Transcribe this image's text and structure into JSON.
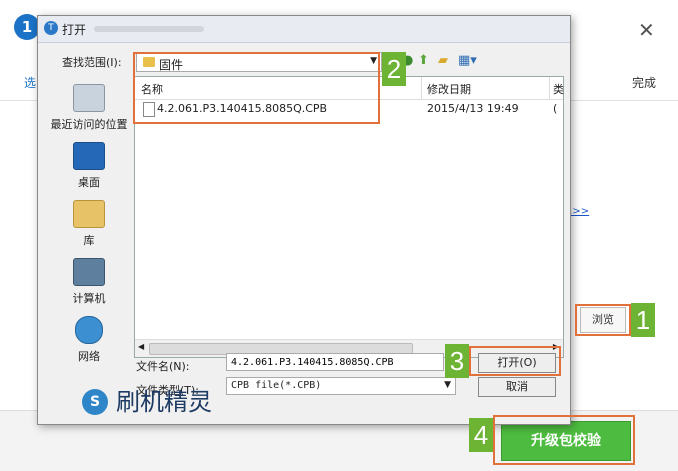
{
  "background": {
    "step_number": "1",
    "close_glyph": "✕",
    "tab_left": "选",
    "tab_right": "完成",
    "link_text": "..>>",
    "browse_label": "浏览",
    "upgrade_label": "升级包校验"
  },
  "dialog": {
    "title": "打开",
    "lookin_label": "查找范围(I):",
    "lookin_value": "固件",
    "places": [
      {
        "label": "最近访问的位置",
        "icon": "recent-places-icon"
      },
      {
        "label": "桌面",
        "icon": "desktop-icon"
      },
      {
        "label": "库",
        "icon": "library-icon"
      },
      {
        "label": "计算机",
        "icon": "computer-icon"
      },
      {
        "label": "网络",
        "icon": "network-icon"
      }
    ],
    "columns": {
      "name": "名称",
      "date": "修改日期",
      "extra": "类"
    },
    "files": [
      {
        "name": "4.2.061.P3.140415.8085Q.CPB",
        "date": "2015/4/13 19:49",
        "extra": "("
      }
    ],
    "filename_label": "文件名(N):",
    "filename_value": "4.2.061.P3.140415.8085Q.CPB",
    "filetype_label": "文件类型(T):",
    "filetype_value": "CPB file(*.CPB)",
    "open_label": "打开(O)",
    "cancel_label": "取消"
  },
  "brand": {
    "name": "刷机精灵",
    "logo_letter": "S"
  },
  "annotations": [
    "1",
    "2",
    "3",
    "4"
  ],
  "colors": {
    "accent": "#1a73c7",
    "highlight": "#e2703a",
    "badge": "#6db334",
    "upgrade": "#4dbb3f"
  }
}
